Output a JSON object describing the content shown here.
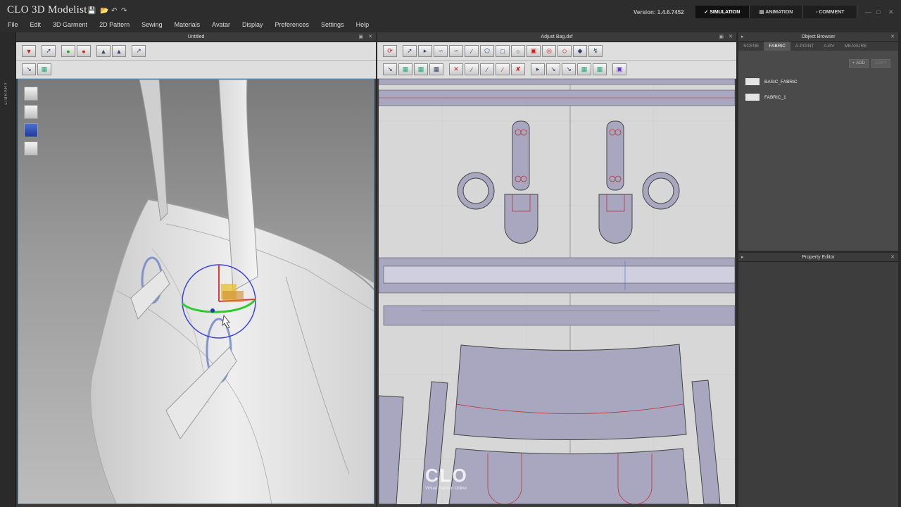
{
  "app": {
    "logo_mark": "CLO",
    "title": "3D Modelist",
    "version": "Version:   1.4.6.7452"
  },
  "modes": [
    "SIMULATION",
    "ANIMATION",
    "COMMENT"
  ],
  "menu": [
    "File",
    "Edit",
    "3D Garment",
    "2D Pattern",
    "Sewing",
    "Materials",
    "Avatar",
    "Display",
    "Preferences",
    "Settings",
    "Help"
  ],
  "library_label": "LIBRARY",
  "panels": {
    "view3d_title": "Untitled",
    "view2d_title": "Adjust Bag.dxf",
    "object_browser_title": "Object Browser",
    "property_editor_title": "Property Editor"
  },
  "object_browser": {
    "tabs": [
      "SCENE",
      "FABRIC",
      "A-POINT",
      "A-BV",
      "MEASURE"
    ],
    "active_tab": "FABRIC",
    "add_label": "ADD",
    "copy_label": "COPY",
    "fabrics": [
      "BASIC_FABRIC",
      "FABRIC_1"
    ]
  },
  "watermark": {
    "brand": "CLO",
    "tagline": "Virtual Fashion Online"
  },
  "colors": {
    "accent": "#2e5d8a",
    "pattern_fill": "#a9a6c0",
    "viewport_border": "#5a8ab0"
  }
}
